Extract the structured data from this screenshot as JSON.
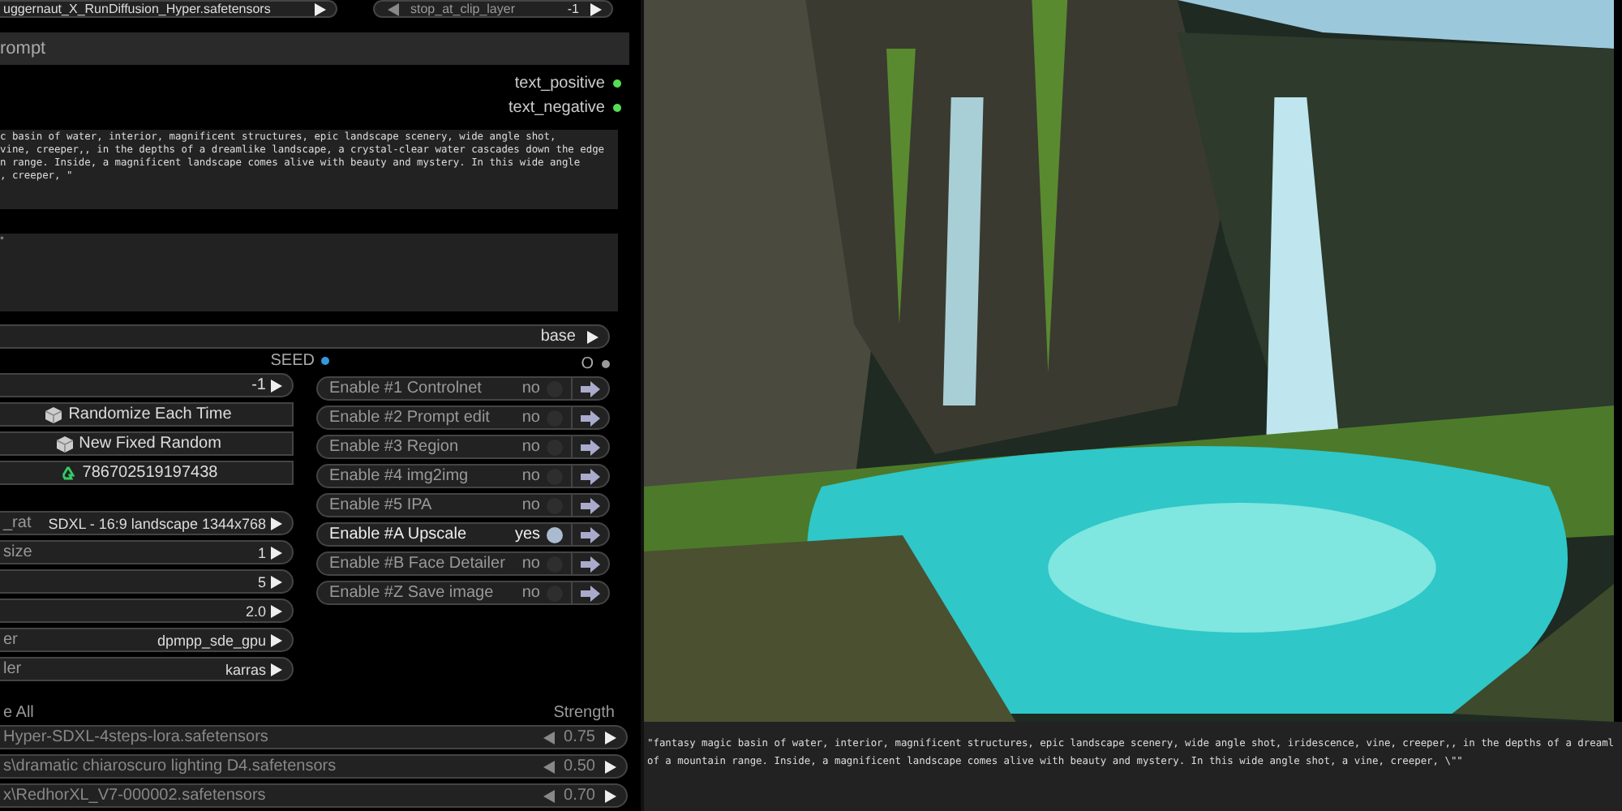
{
  "top_bar": {
    "model": "uggernaut_X_RunDiffusion_Hyper.safetensors",
    "clip_label": "stop_at_clip_layer",
    "clip_value": "-1"
  },
  "prompt_header": "rompt",
  "outputs": [
    "text_positive",
    "text_negative"
  ],
  "positive_prompt": [
    "c basin of water, interior, magnificent structures, epic landscape scenery, wide angle shot,",
    "vine, creeper,, in the depths of a dreamlike landscape, a crystal-clear water cascades down the edge",
    "n range. Inside, a magnificent landscape comes alive with beauty and mystery. In this wide angle",
    ", creeper, \""
  ],
  "negative_prompt": {
    "mark": "•"
  },
  "base_combo": "base",
  "seed": {
    "label": "SEED",
    "value": "-1",
    "buttons": [
      {
        "kind": "dice",
        "label": "Randomize Each Time"
      },
      {
        "kind": "dice",
        "label": "New Fixed Random"
      },
      {
        "kind": "recycle",
        "label": "786702519197438"
      }
    ]
  },
  "settings": [
    {
      "label": "_rat",
      "value": "SDXL - 16:9 landscape 1344x768"
    },
    {
      "label": "size",
      "value": "1"
    },
    {
      "value": "5"
    },
    {
      "value": "2.0"
    },
    {
      "label": "er",
      "value": "dpmpp_sde_gpu"
    },
    {
      "label": "ler",
      "value": "karras"
    }
  ],
  "switch_header": "O",
  "switches": [
    {
      "label": "Enable #1 Controlnet",
      "state": "no",
      "on": false
    },
    {
      "label": "Enable #2 Prompt edit",
      "state": "no",
      "on": false
    },
    {
      "label": "Enable #3 Region",
      "state": "no",
      "on": false
    },
    {
      "label": "Enable #4 img2img",
      "state": "no",
      "on": false
    },
    {
      "label": "Enable #5 IPA",
      "state": "no",
      "on": false
    },
    {
      "label": "Enable #A Upscale",
      "state": "yes",
      "on": true
    },
    {
      "label": "Enable #B Face Detailer",
      "state": "no",
      "on": false
    },
    {
      "label": "Enable #Z Save image",
      "state": "no",
      "on": false
    }
  ],
  "lora_header": {
    "toggle_all": "e All",
    "strength": "Strength"
  },
  "loras": [
    {
      "name": "Hyper-SDXL-4steps-lora.safetensors",
      "strength": "0.75"
    },
    {
      "name": "s\\dramatic chiaroscuro lighting D4.safetensors",
      "strength": "0.50"
    },
    {
      "name": "x\\RedhorXL_V7-000002.safetensors",
      "strength": "0.70"
    }
  ],
  "preview": {
    "kind": "picture"
  },
  "output_text": [
    "\"fantasy magic basin of water, interior, magnificent structures, epic landscape scenery, wide angle shot, iridescence, vine, creeper,, in the depths of a dreaml",
    "of a mountain range. Inside, a magnificent landscape comes alive with beauty and mystery. In this wide angle shot, a vine, creeper, \\\"\""
  ]
}
